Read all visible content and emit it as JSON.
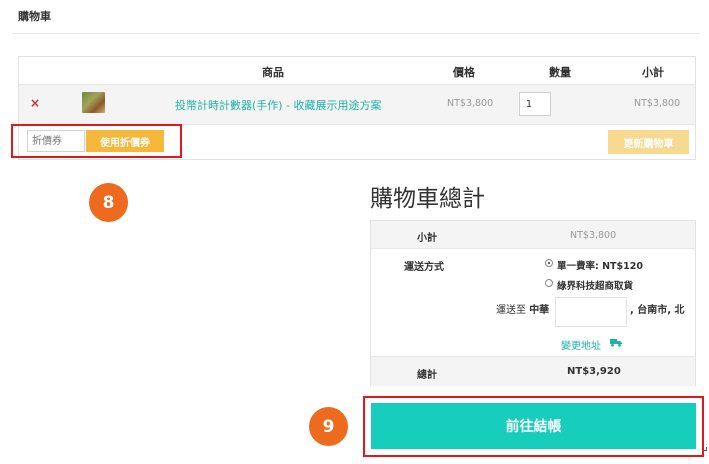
{
  "page": {
    "title": "購物車"
  },
  "cart": {
    "columns": {
      "product": "商品",
      "price": "價格",
      "quantity": "數量",
      "subtotal": "小計"
    },
    "items": [
      {
        "remove_icon": "close-icon",
        "remove_glyph": "×",
        "product_name": "投幣計時計數器(手作) - 收藏展示用途方案",
        "price": "NT$3,800",
        "quantity": "1",
        "subtotal": "NT$3,800"
      }
    ],
    "coupon_placeholder": "折價券",
    "apply_coupon_label": "使用折價券",
    "update_cart_label": "更新購物車"
  },
  "totals": {
    "heading": "購物車總計",
    "subtotal_label": "小計",
    "subtotal_value": "NT$3,800",
    "shipping_label": "運送方式",
    "shipping_options": [
      {
        "label": "單一費率: NT$120",
        "checked": true
      },
      {
        "label": "綠界科技超商取貨",
        "checked": false
      }
    ],
    "ship_to_prefix": "運送至",
    "ship_to_country": "中華",
    "ship_to_city": ", 台南市, 北",
    "change_address_label": "變更地址",
    "change_address_icon": "truck-icon",
    "total_label": "總計",
    "total_value": "NT$3,920"
  },
  "checkout": {
    "label": "前往結帳"
  },
  "annotations": {
    "step_8": "8",
    "step_9": "9",
    "highlight_color": "#e0191b",
    "badge_color": "#ee6a1e"
  },
  "colors": {
    "accent": "#17cdbc",
    "link": "#1fb2a5",
    "coupon_button": "#f5b83a",
    "update_button": "#f7d98f",
    "remove": "#d9262b"
  }
}
